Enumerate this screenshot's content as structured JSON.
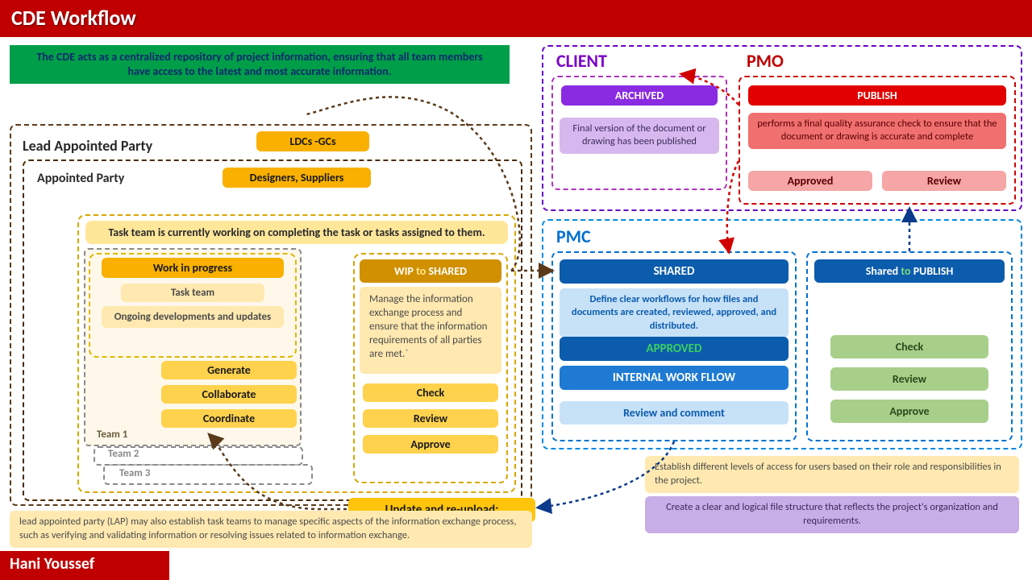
{
  "title": "CDE Workflow",
  "intro": "The CDE acts as a centralized repository of project information, ensuring that all team members have access to the latest and most accurate information.",
  "lead": {
    "label": "Lead Appointed Party",
    "tag": "LDCs -GCs"
  },
  "appointed": {
    "label": "Appointed Party",
    "tag": "Designers, Suppliers",
    "banner": "Task team is currently working on completing the task or tasks assigned to them.",
    "wip": {
      "title": "Work in progress",
      "s1": "Task team",
      "s2": "Ongoing developments and updates",
      "step1": "Generate",
      "step2": "Collaborate",
      "step3": "Coordinate"
    },
    "team1": "Team 1",
    "team2": "Team 2",
    "team3": "Team 3",
    "wip2s": {
      "title_pre": "WIP",
      "title_to": "to",
      "title_post": "SHARED",
      "body": "Manage the information exchange process and ensure that the information requirements of all parties are met.`",
      "c1": "Check",
      "c2": "Review",
      "c3": "Approve"
    }
  },
  "update": "Update and re-upload:",
  "lap_note": "lead appointed party (LAP) may also establish task teams to manage specific aspects of the information exchange process, such as verifying and validating information or resolving issues related to information exchange.",
  "client": {
    "title": "CLIENT",
    "archived": "ARCHIVED",
    "archived_body": "Final version of the document or drawing has been published"
  },
  "pmo": {
    "title": "PMO",
    "publish": "PUBLISH",
    "publish_body": "performs a final quality assurance check to ensure that the document or drawing is accurate and complete",
    "b1": "Approved",
    "b2": "Review"
  },
  "pmc": {
    "title": "PMC",
    "shared": "SHARED",
    "shared_desc": "Define clear workflows for how files and documents are created, reviewed, approved, and distributed.",
    "approved": "APPROVED",
    "iwf": "INTERNAL WORK FLLOW",
    "review": "Review and comment",
    "s2p_pre": "Shared",
    "s2p_to": "to",
    "s2p_post": "PUBLISH",
    "g1": "Check",
    "g2": "Review",
    "g3": "Approve"
  },
  "note_access": "Establish different levels of access for users based on their role and responsibilities in the project.",
  "note_structure": "Create a clear and logical file structure that reflects the project's organization and requirements.",
  "author": "Hani Youssef"
}
